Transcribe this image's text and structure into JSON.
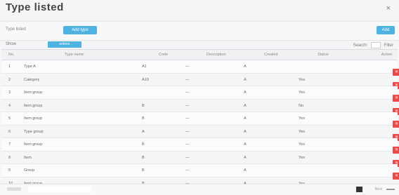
{
  "title": "Type listed",
  "close_icon": "×",
  "toolbar": {
    "label": "Type listed",
    "tag": "Add type",
    "right_button": "Add"
  },
  "filterbar": {
    "left": "Show",
    "chip": "entries",
    "right_label": "Search:",
    "right_suffix": "Filter"
  },
  "table": {
    "headers": [
      "No.",
      "Type name",
      "Code",
      "Description",
      "Created",
      "Status",
      "Action"
    ],
    "rows": [
      [
        "1",
        "Type A",
        "A1",
        "—",
        "A",
        ""
      ],
      [
        "2",
        "Category",
        "A10",
        "—",
        "A",
        "Yes"
      ],
      [
        "3",
        "Item group",
        "",
        "—",
        "A",
        "Yes"
      ],
      [
        "4",
        "Item group",
        "B",
        "—",
        "A",
        "No"
      ],
      [
        "5",
        "Item group",
        "B",
        "—",
        "A",
        "Yes"
      ],
      [
        "6",
        "Type group",
        "A",
        "—",
        "A",
        "Yes"
      ],
      [
        "7",
        "Item group",
        "B",
        "—",
        "A",
        "Yes"
      ],
      [
        "8",
        "Item",
        "B",
        "—",
        "A",
        "Yes"
      ],
      [
        "9",
        "Group",
        "B",
        "—",
        "A",
        ""
      ],
      [
        "10",
        "Item group",
        "B",
        "—",
        "A",
        "Yes"
      ]
    ]
  },
  "footer": {
    "text": "Next"
  },
  "colors": {
    "accent": "#4fb3e2",
    "danger": "#e84a4a"
  },
  "icons": {
    "edit": "pencil-icon",
    "delete": "trash-icon"
  }
}
